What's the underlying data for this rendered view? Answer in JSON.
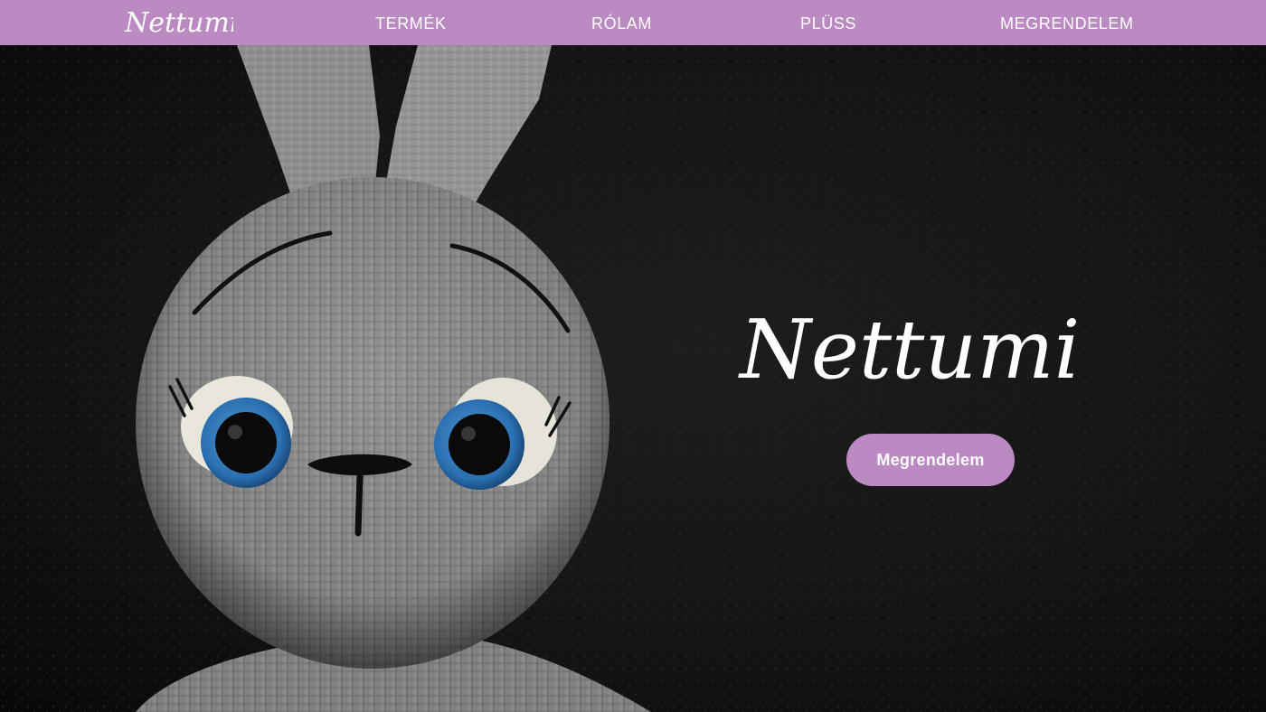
{
  "brand": {
    "name": "Nettumi",
    "color_primary": "#bb8ac2",
    "text_color": "#ffffff"
  },
  "nav": {
    "logo_text": "Nettumi",
    "links": [
      {
        "label": "TERMÉK"
      },
      {
        "label": "RÓLAM"
      },
      {
        "label": "PLÜSS"
      },
      {
        "label": "MEGRENDELEM"
      }
    ]
  },
  "hero": {
    "logo_text": "Nettumi",
    "cta_label": "Megrendelem",
    "image_subject": "crocheted-grey-bunny-plush"
  }
}
